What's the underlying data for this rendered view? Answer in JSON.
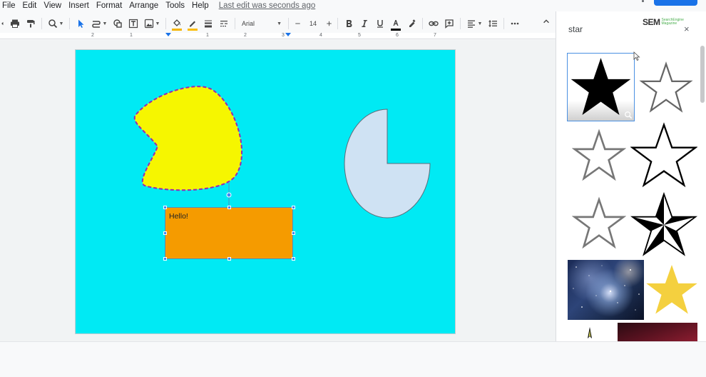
{
  "menu": {
    "items": [
      "File",
      "Edit",
      "View",
      "Insert",
      "Format",
      "Arrange",
      "Tools",
      "Help"
    ],
    "last_edit": "Last edit was seconds ago"
  },
  "toolbar": {
    "font": "Arial",
    "font_size": "14",
    "fill_color": "#f4b400",
    "border_color": "#fbbc04",
    "text_color": "#000000"
  },
  "ruler": {
    "numbers": [
      "2",
      "1",
      "1",
      "2",
      "3",
      "4",
      "5",
      "6",
      "7"
    ]
  },
  "slide": {
    "background": "#00eaf4",
    "textbox_text": "Hello!"
  },
  "panel": {
    "query": "star",
    "logo_main": "SEM",
    "logo_sub": "SearchEngine Magazine",
    "close": "×"
  },
  "colors": {
    "blob_fill": "#f6f600",
    "blob_border": "#9c27b0",
    "textbox_fill": "#f59b00",
    "pie_fill": "#cfe2f3",
    "accent": "#1a73e8"
  },
  "icons": [
    "print-icon",
    "paint-format-icon",
    "zoom-icon",
    "cursor-icon",
    "line-icon",
    "shape-icon",
    "textbox-icon",
    "image-icon",
    "fill-color-icon",
    "border-color-icon",
    "border-weight-icon",
    "border-dash-icon",
    "bold-icon",
    "italic-icon",
    "underline-icon",
    "text-color-icon",
    "highlight-icon",
    "link-icon",
    "comment-icon",
    "align-icon",
    "line-spacing-icon",
    "more-icon",
    "close-icon",
    "search-icon"
  ]
}
